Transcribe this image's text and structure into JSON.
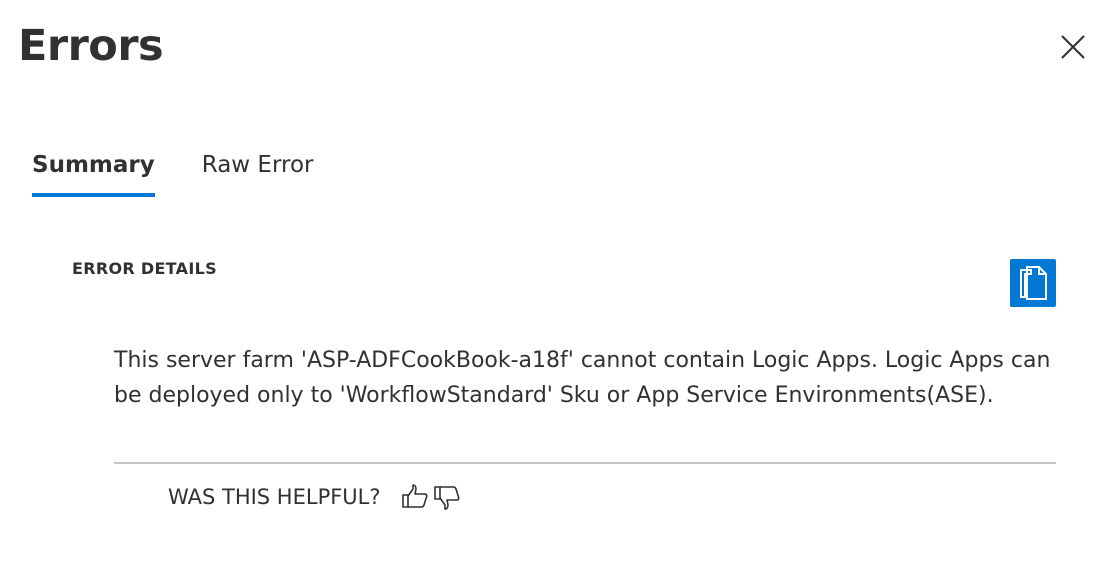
{
  "dialog": {
    "title": "Errors"
  },
  "tabs": [
    {
      "label": "Summary",
      "active": true
    },
    {
      "label": "Raw Error",
      "active": false
    }
  ],
  "error_details": {
    "section_label": "ERROR DETAILS",
    "message": "This server farm 'ASP-ADFCookBook-a18f' cannot contain Logic Apps. Logic Apps can be deployed only to 'WorkflowStandard' Sku or App Service Environments(ASE).",
    "copy_icon": "copy-icon"
  },
  "feedback": {
    "label": "WAS THIS HELPFUL?",
    "thumbs_up_icon": "thumbs-up-icon",
    "thumbs_down_icon": "thumbs-down-icon"
  },
  "colors": {
    "accent": "#0078d4",
    "text": "#323130",
    "divider": "#c8c6c4"
  }
}
